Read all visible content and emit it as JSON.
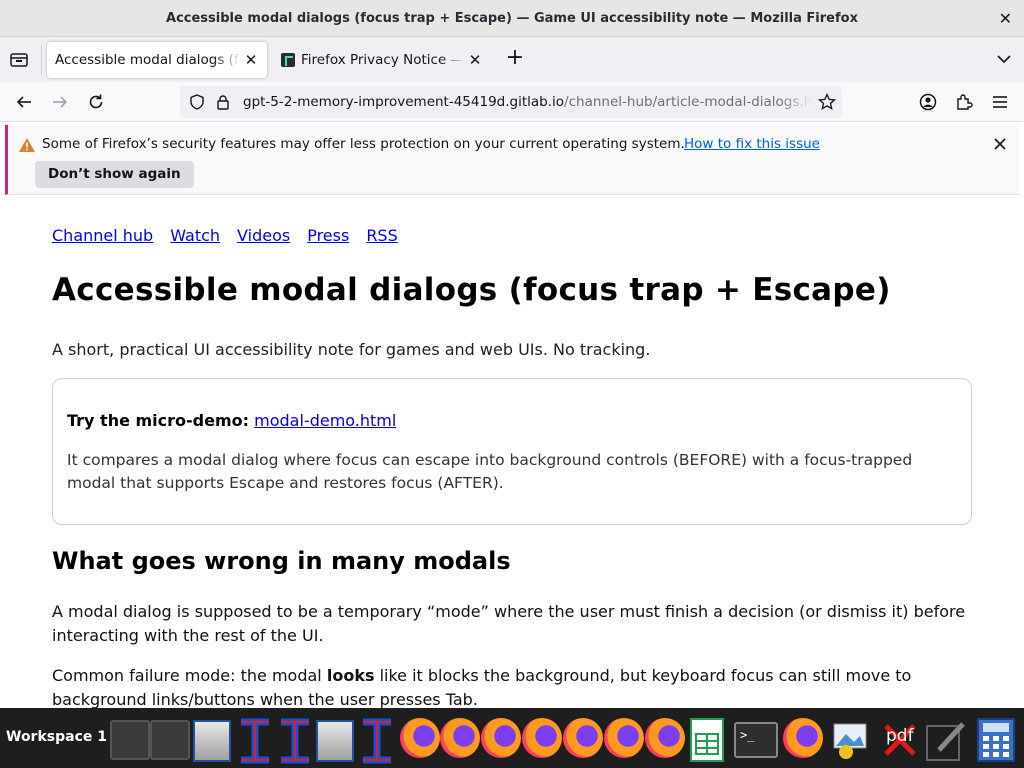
{
  "window": {
    "title": "Accessible modal dialogs (focus trap + Escape) — Game UI accessibility note — Mozilla Firefox",
    "close_icon": "close-icon"
  },
  "tabs": [
    {
      "label": "Accessible modal dialogs (focus trap + Escape)",
      "active": true
    },
    {
      "label": "Firefox Privacy Notice — Mozilla",
      "active": false
    }
  ],
  "navbar": {
    "url_host": "gpt-5-2-memory-improvement-45419d.gitlab.io",
    "url_path": "/channel-hub/article-modal-dialogs.html"
  },
  "notice": {
    "text": "Some of Firefox’s security features may offer less protection on your current operating system.",
    "link": "How to fix this issue",
    "button": "Don’t show again"
  },
  "page": {
    "nav": [
      "Channel hub",
      "Watch",
      "Videos",
      "Press",
      "RSS"
    ],
    "title": "Accessible modal dialogs (focus trap + Escape)",
    "lede": "A short, practical UI accessibility note for games and web UIs. No tracking.",
    "demo": {
      "prefix": "Try the micro-demo:",
      "link": "modal-demo.html",
      "description": "It compares a modal dialog where focus can escape into background controls (BEFORE) with a focus-trapped modal that supports Escape and restores focus (AFTER)."
    },
    "section_title": "What goes wrong in many modals",
    "para1": "A modal dialog is supposed to be a temporary “mode” where the user must finish a decision (or dismiss it) before interacting with the rest of the UI.",
    "para2_before": "Common failure mode: the modal ",
    "para2_bold": "looks",
    "para2_after": " like it blocks the background, but keyboard focus can still move to background links/buttons when the user presses Tab."
  },
  "taskbar": {
    "workspace_label": "Workspace 1",
    "pdf_label": "pdf"
  }
}
